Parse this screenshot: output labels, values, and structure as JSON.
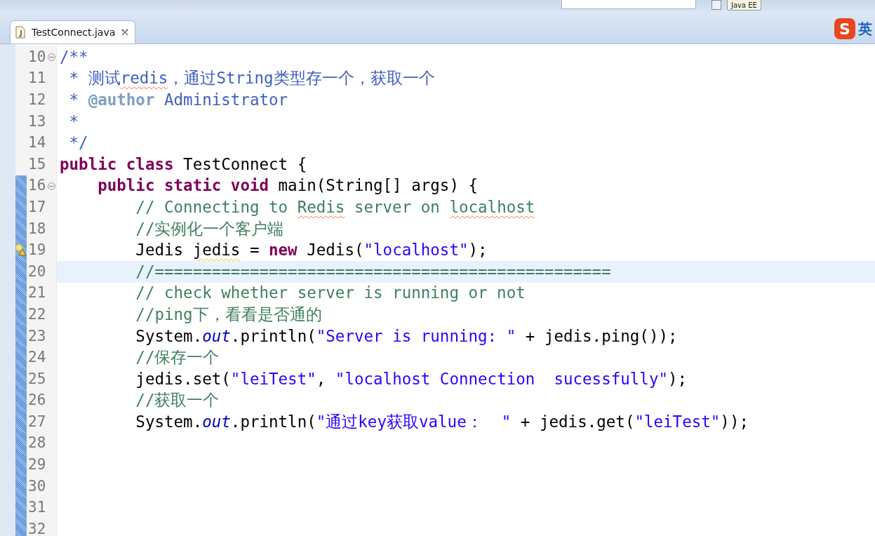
{
  "toolbar": {
    "perspective": "Java EE"
  },
  "tabs": [
    {
      "label": "TestConnect.java",
      "selected": true
    }
  ],
  "ime_indicator": {
    "logo": "S",
    "mode": "英"
  },
  "editor": {
    "lines": [
      {
        "number": "10",
        "changed": false,
        "current": false,
        "fold_expanded": true,
        "tokens": [
          {
            "t": "/**",
            "kind": "doc"
          }
        ]
      },
      {
        "number": "11",
        "changed": false,
        "current": false,
        "tokens": [
          {
            "t": " * 测试",
            "kind": "doc"
          },
          {
            "t": "redis",
            "kind": "doc",
            "misspelled": true
          },
          {
            "t": "，通过String类型存一个，获取一个",
            "kind": "doc"
          }
        ]
      },
      {
        "number": "12",
        "changed": false,
        "current": false,
        "tokens": [
          {
            "t": " * ",
            "kind": "doc"
          },
          {
            "t": "@author",
            "kind": "tag"
          },
          {
            "t": " Administrator",
            "kind": "doc"
          }
        ]
      },
      {
        "number": "13",
        "changed": false,
        "current": false,
        "tokens": [
          {
            "t": " *",
            "kind": "doc"
          }
        ]
      },
      {
        "number": "14",
        "changed": false,
        "current": false,
        "tokens": [
          {
            "t": " */",
            "kind": "doc"
          }
        ]
      },
      {
        "number": "15",
        "changed": false,
        "current": false,
        "tokens": [
          {
            "t": "public class",
            "kind": "keyword"
          },
          {
            "t": " TestConnect {",
            "kind": "plain"
          }
        ]
      },
      {
        "number": "16",
        "changed": true,
        "current": false,
        "fold_expanded": true,
        "tokens": [
          {
            "t": "    public static void",
            "kind": "keyword"
          },
          {
            "t": " main(String[] args) {",
            "kind": "plain"
          }
        ]
      },
      {
        "number": "17",
        "changed": true,
        "current": false,
        "tokens": [
          {
            "t": "        // Connecting to ",
            "kind": "comment"
          },
          {
            "t": "Redis",
            "kind": "comment",
            "misspelled": true
          },
          {
            "t": " server on ",
            "kind": "comment"
          },
          {
            "t": "localhost",
            "kind": "comment",
            "misspelled": true
          }
        ]
      },
      {
        "number": "18",
        "changed": true,
        "current": false,
        "tokens": [
          {
            "t": "        //实例化一个客户端",
            "kind": "comment"
          }
        ]
      },
      {
        "number": "19",
        "changed": true,
        "current": false,
        "warning": true,
        "tokens": [
          {
            "t": "        Jedis ",
            "kind": "plain"
          },
          {
            "t": "jedis",
            "kind": "plain",
            "warning": true
          },
          {
            "t": " = ",
            "kind": "plain"
          },
          {
            "t": "new",
            "kind": "keyword"
          },
          {
            "t": " Jedis(",
            "kind": "plain"
          },
          {
            "t": "\"localhost\"",
            "kind": "string"
          },
          {
            "t": ");",
            "kind": "plain"
          }
        ]
      },
      {
        "number": "20",
        "changed": true,
        "current": true,
        "tokens": [
          {
            "t": "        //================================================",
            "kind": "comment"
          }
        ]
      },
      {
        "number": "21",
        "changed": true,
        "current": false,
        "tokens": [
          {
            "t": "        // check whether server is running or not",
            "kind": "comment"
          }
        ]
      },
      {
        "number": "22",
        "changed": true,
        "current": false,
        "tokens": [
          {
            "t": "        //ping下，看看是否通的",
            "kind": "comment"
          }
        ]
      },
      {
        "number": "23",
        "changed": true,
        "current": false,
        "tokens": [
          {
            "t": "        System.",
            "kind": "plain"
          },
          {
            "t": "out",
            "kind": "field"
          },
          {
            "t": ".println(",
            "kind": "plain"
          },
          {
            "t": "\"Server is running: \"",
            "kind": "string"
          },
          {
            "t": " + jedis.ping());",
            "kind": "plain"
          }
        ]
      },
      {
        "number": "24",
        "changed": true,
        "current": false,
        "tokens": [
          {
            "t": "        //保存一个",
            "kind": "comment"
          }
        ]
      },
      {
        "number": "25",
        "changed": true,
        "current": false,
        "tokens": [
          {
            "t": "        jedis.set(",
            "kind": "plain"
          },
          {
            "t": "\"leiTest\"",
            "kind": "string"
          },
          {
            "t": ", ",
            "kind": "plain"
          },
          {
            "t": "\"localhost Connection  sucessfully\"",
            "kind": "string"
          },
          {
            "t": ");",
            "kind": "plain"
          }
        ]
      },
      {
        "number": "26",
        "changed": true,
        "current": false,
        "tokens": [
          {
            "t": "        //获取一个",
            "kind": "comment"
          }
        ]
      },
      {
        "number": "27",
        "changed": true,
        "current": false,
        "tokens": [
          {
            "t": "        System.",
            "kind": "plain"
          },
          {
            "t": "out",
            "kind": "field"
          },
          {
            "t": ".println(",
            "kind": "plain"
          },
          {
            "t": "\"通过key获取value：  \"",
            "kind": "string"
          },
          {
            "t": " + jedis.get(",
            "kind": "plain"
          },
          {
            "t": "\"leiTest\"",
            "kind": "string"
          },
          {
            "t": "));",
            "kind": "plain"
          }
        ]
      },
      {
        "number": "28",
        "changed": true,
        "current": false
      },
      {
        "number": "29",
        "changed": true,
        "current": false
      },
      {
        "number": "30",
        "changed": true,
        "current": false
      },
      {
        "number": "31",
        "changed": true,
        "current": false
      },
      {
        "number": "32",
        "changed": true,
        "current": false
      }
    ]
  }
}
